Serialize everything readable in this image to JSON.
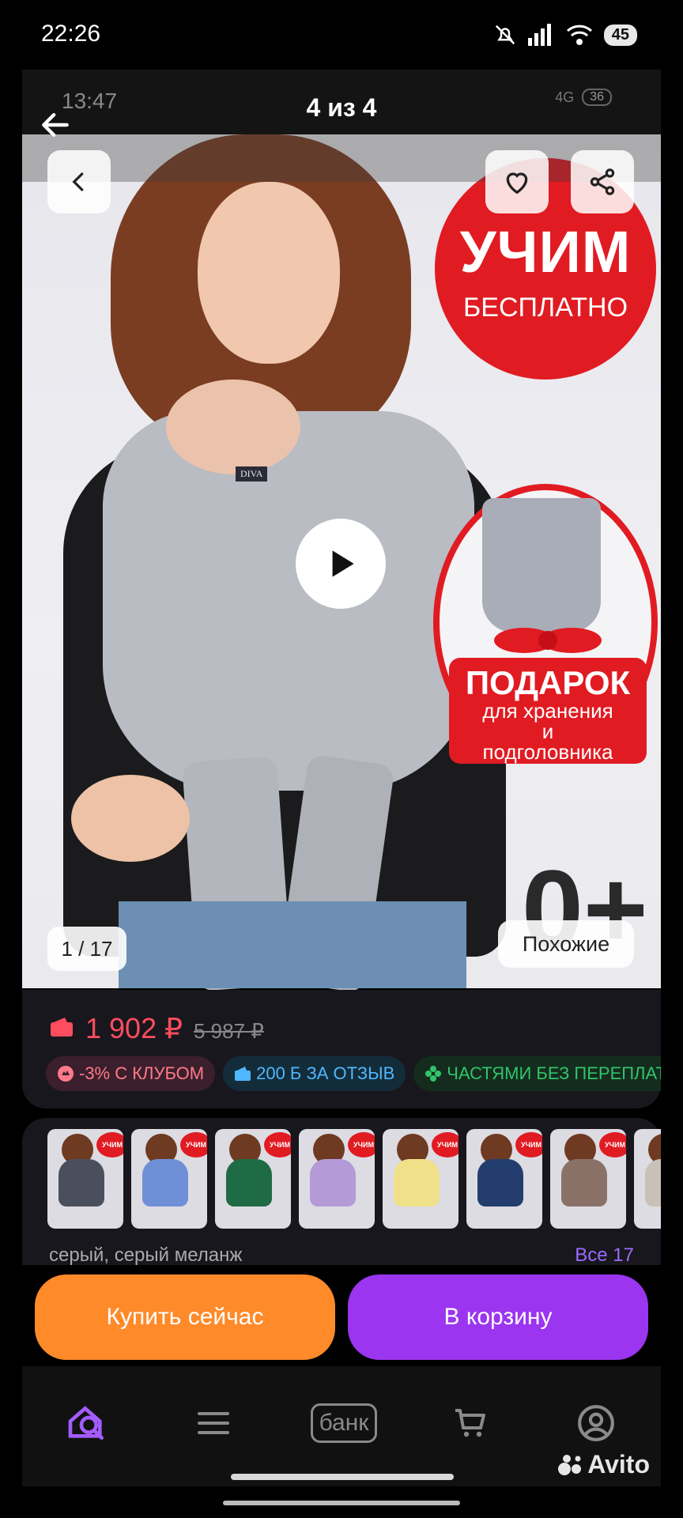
{
  "status_bar": {
    "time": "22:26",
    "battery": "45"
  },
  "inner_status": {
    "time": "13:47",
    "battery": "36",
    "network": "4G"
  },
  "viewer": {
    "counter": "4 из 4"
  },
  "photo": {
    "promo_title": "УЧИМ",
    "promo_subtitle": "БЕСПЛАТНО",
    "gift_title": "ПОДАРОК",
    "gift_line1": "для хранения",
    "gift_line2": "и",
    "gift_line3": "подголовника",
    "age_mark": "0+",
    "brand_tag": "DIVA",
    "page_indicator": "1 / 17",
    "similar_label": "Похожие"
  },
  "price": {
    "current": "1 902 ₽",
    "old": "5 987 ₽"
  },
  "chips": [
    {
      "label": "-3% С КЛУБОМ"
    },
    {
      "label": "200 Б ЗА ОТЗЫВ"
    },
    {
      "label": "ЧАСТЯМИ БЕЗ ПЕРЕПЛАТ"
    }
  ],
  "variants": {
    "selected_name": "серый, серый меланж",
    "all_label": "Все 17",
    "thumb_badge": "УЧИМ",
    "thumbs": [
      {
        "color": "#4a4f5e"
      },
      {
        "color": "#6f8fd6"
      },
      {
        "color": "#1f6b45"
      },
      {
        "color": "#b49ad6"
      },
      {
        "color": "#f0e08a"
      },
      {
        "color": "#233e6e"
      },
      {
        "color": "#8a7167"
      },
      {
        "color": "#c9c0b8"
      }
    ]
  },
  "actions": {
    "buy_now": "Купить сейчас",
    "add_to_cart": "В корзину"
  },
  "nav": {
    "bank_label": "банк"
  },
  "brand": {
    "logo": "Avito"
  },
  "colors": {
    "accent_purple": "#9b35f0",
    "accent_orange": "#ff8a2a",
    "promo_red": "#e11b22"
  }
}
